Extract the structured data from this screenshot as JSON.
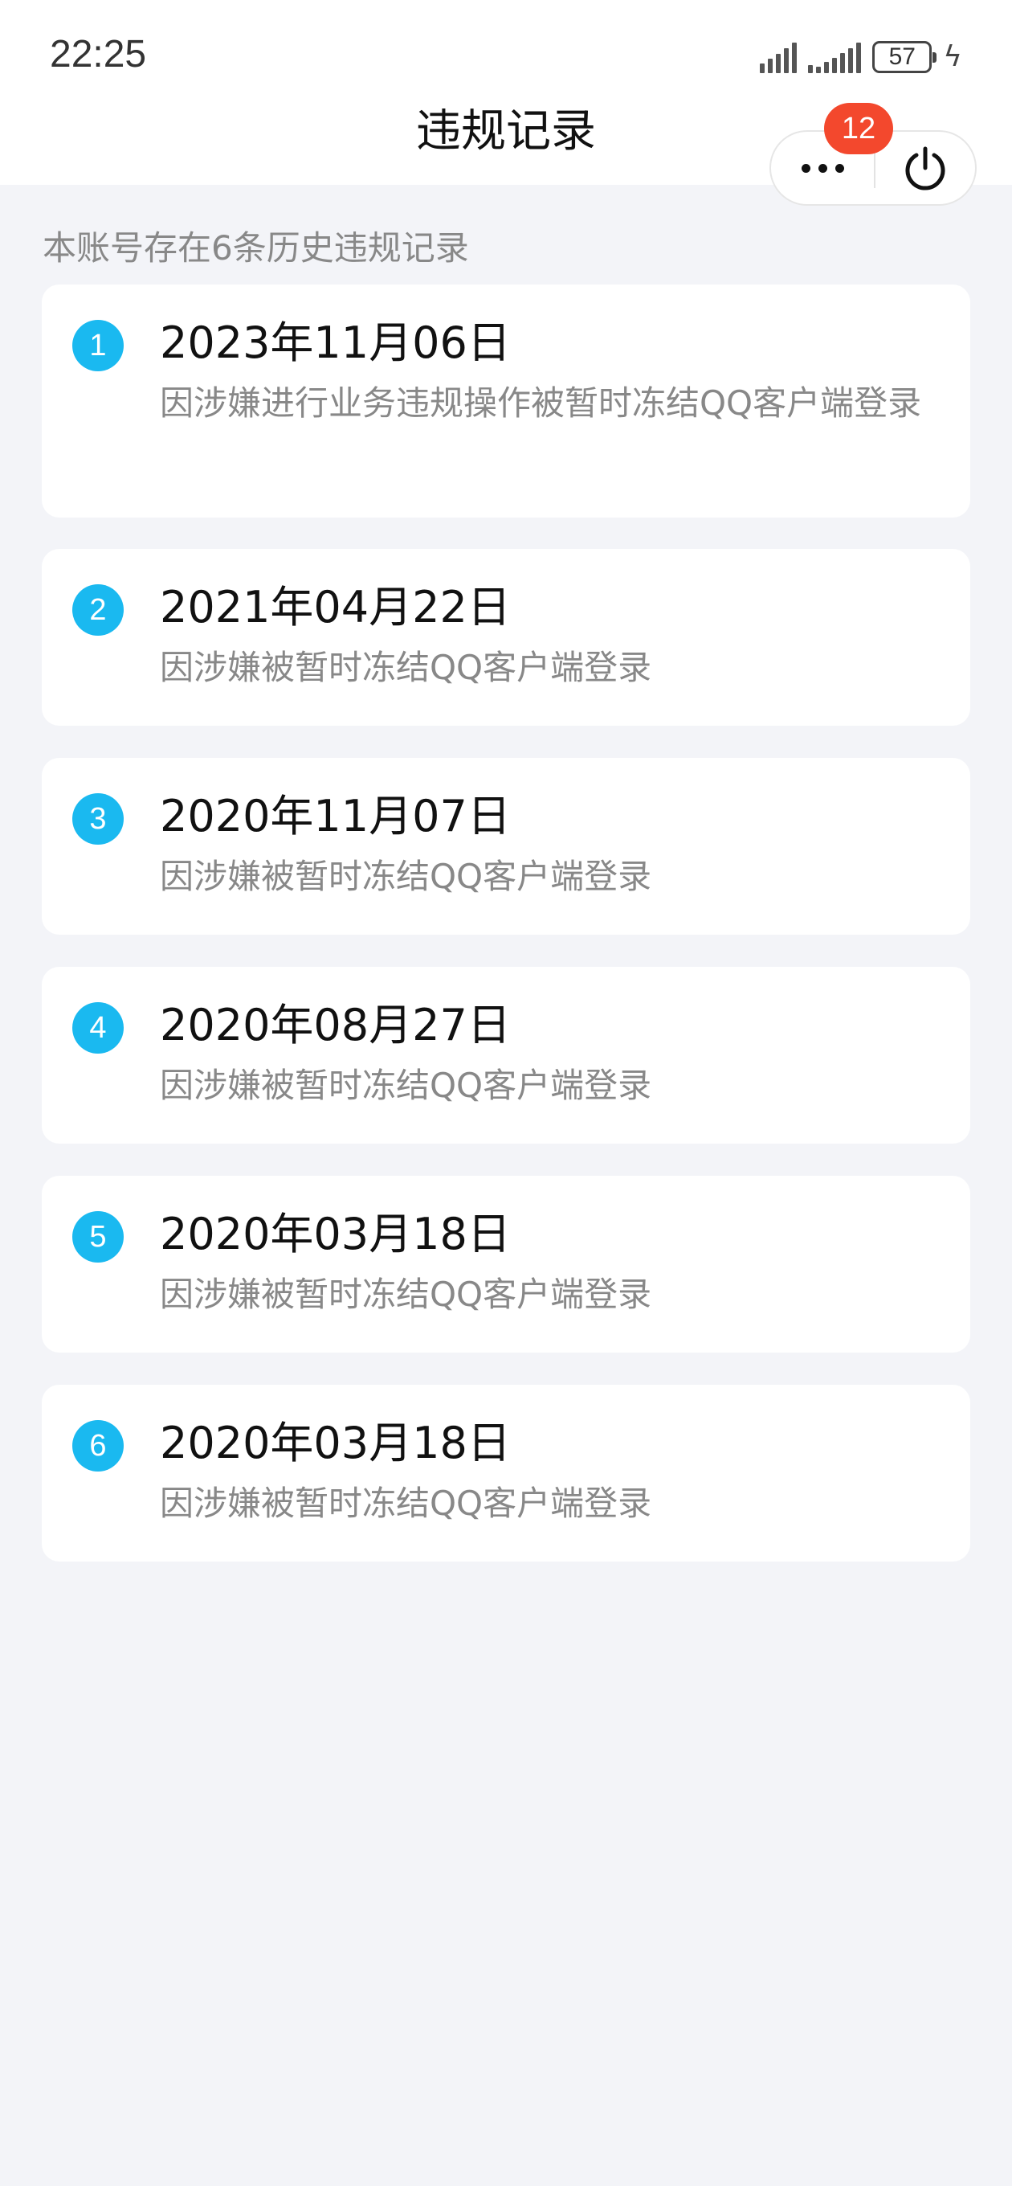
{
  "status_bar": {
    "time": "22:25",
    "battery": "57"
  },
  "header": {
    "title": "违规记录",
    "badge": "12"
  },
  "summary": "本账号存在6条历史违规记录",
  "records": [
    {
      "index": "1",
      "date": "2023年11月06日",
      "reason": "因涉嫌进行业务违规操作被暂时冻结QQ客户端登录"
    },
    {
      "index": "2",
      "date": "2021年04月22日",
      "reason": "因涉嫌被暂时冻结QQ客户端登录"
    },
    {
      "index": "3",
      "date": "2020年11月07日",
      "reason": "因涉嫌被暂时冻结QQ客户端登录"
    },
    {
      "index": "4",
      "date": "2020年08月27日",
      "reason": "因涉嫌被暂时冻结QQ客户端登录"
    },
    {
      "index": "5",
      "date": "2020年03月18日",
      "reason": "因涉嫌被暂时冻结QQ客户端登录"
    },
    {
      "index": "6",
      "date": "2020年03月18日",
      "reason": "因涉嫌被暂时冻结QQ客户端登录"
    }
  ]
}
